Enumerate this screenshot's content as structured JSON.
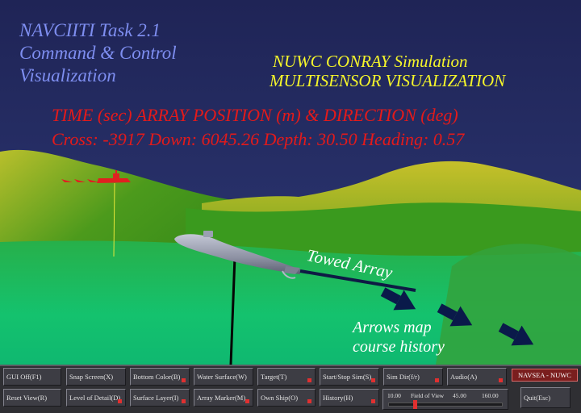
{
  "scene": {
    "title_lines": [
      "NAVCIITI Task 2.1",
      "Command & Control",
      "Visualization"
    ],
    "sim_lines": [
      "NUWC CONRAY Simulation",
      "MULTISENSOR VISUALIZATION"
    ],
    "status_header": "TIME (sec)  ARRAY POSITION (m) & DIRECTION (deg)",
    "status_values": "Cross: -3917  Down: 6045.26  Depth: 30.50  Heading: 0.57",
    "towed_array_label": "Towed Array",
    "arrows_label_lines": [
      "Arrows map",
      "course history"
    ],
    "colors": {
      "sky": "#232a60",
      "terrain": "#2f8a1a",
      "terrain_highlight": "#c9c22c",
      "sea": "#19c06a",
      "ship": "#e02020",
      "submarine": "#8f94a6",
      "arrow": "#0a1a4a"
    }
  },
  "toolbar": {
    "row1": [
      {
        "label": "GUI Off(F1)"
      },
      {
        "label": "Snap Screen(X)"
      },
      {
        "label": "Bottom Color(B)"
      },
      {
        "label": "Water Surface(W)"
      },
      {
        "label": "Target(T)"
      },
      {
        "label": "Start/Stop Sim(S)"
      },
      {
        "label": "Sim Dir(f/r)"
      },
      {
        "label": "Audio(A)"
      }
    ],
    "row2": [
      {
        "label": "Reset View(R)"
      },
      {
        "label": "Level of Detail(D)"
      },
      {
        "label": "Surface Layer(I)"
      },
      {
        "label": "Array Marker(M)"
      },
      {
        "label": "Own Ship(O)"
      },
      {
        "label": "History(H)"
      }
    ],
    "navsea_label": "NAVSEA - NUWC",
    "quit_label": "Quit(Esc)",
    "fov": {
      "label": "Field of View",
      "min": "10.00",
      "max": "160.00",
      "value": "45.00",
      "value_num": 45
    }
  }
}
